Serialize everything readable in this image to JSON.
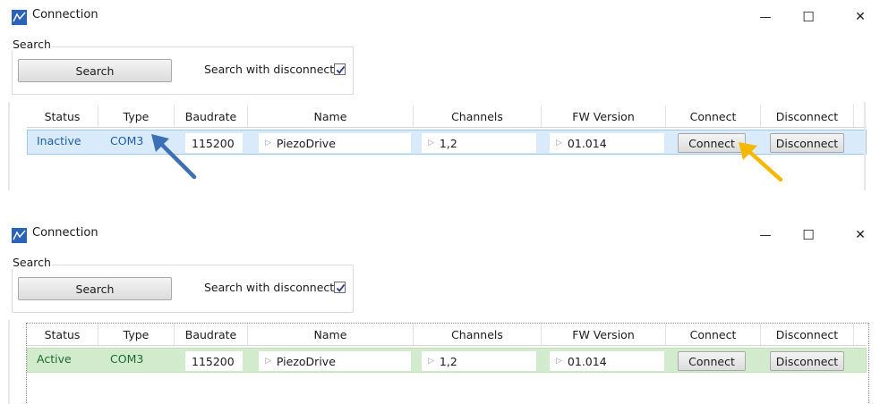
{
  "panels": [
    {
      "title": "Connection",
      "search_group_label": "Search",
      "search_button": "Search",
      "search_with_disconnect_label": "Search with disconnect",
      "columns": [
        "Status",
        "Type",
        "Baudrate",
        "Name",
        "Channels",
        "FW Version",
        "Connect",
        "Disconnect"
      ],
      "row": {
        "status": "Inactive",
        "type": "COM3",
        "baudrate": "115200",
        "name": "PiezoDrive",
        "channels": "1,2",
        "fw_version": "01.014",
        "connect": "Connect",
        "disconnect": "Disconnect"
      }
    },
    {
      "title": "Connection",
      "search_group_label": "Search",
      "search_button": "Search",
      "search_with_disconnect_label": "Search with disconnect",
      "columns": [
        "Status",
        "Type",
        "Baudrate",
        "Name",
        "Channels",
        "FW Version",
        "Connect",
        "Disconnect"
      ],
      "row": {
        "status": "Active",
        "type": "COM3",
        "baudrate": "115200",
        "name": "PiezoDrive",
        "channels": "1,2",
        "fw_version": "01.014",
        "connect": "Connect",
        "disconnect": "Disconnect"
      }
    }
  ],
  "window_controls": {
    "minimize": "—",
    "maximize": "☐",
    "close": "✕"
  },
  "colors": {
    "inactive_row": "#d9ebfb",
    "active_row": "#d3ebcd",
    "link_blue": "#1e5ba8",
    "blue_arrow": "#3d6fb6",
    "yellow_arrow": "#f5b800"
  },
  "icons": {
    "app": "chart-line-icon",
    "checkbox": "checkmark-icon",
    "expand": "triangle-right-icon"
  }
}
